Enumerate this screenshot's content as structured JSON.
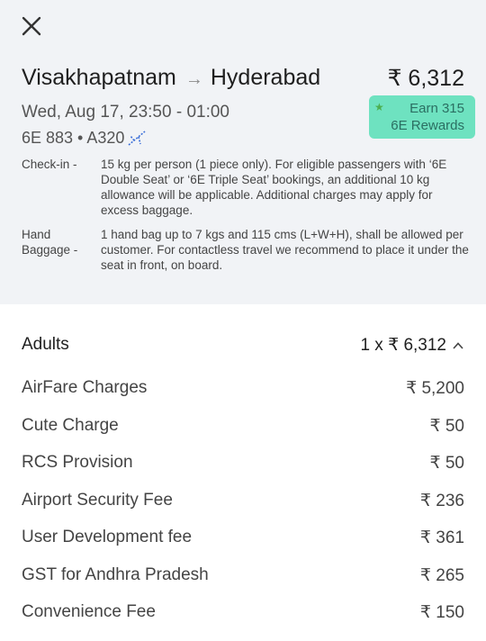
{
  "header": {
    "origin": "Visakhapatnam",
    "arrow": "→",
    "destination": "Hyderabad",
    "price": "₹ 6,312",
    "datetime": "Wed, Aug 17, 23:50 - 01:00",
    "flight": "6E 883 • A320",
    "rewards_line1": "Earn 315",
    "rewards_line2": "6E Rewards"
  },
  "baggage": {
    "checkin_label": "Check-in -",
    "checkin_text": "15 kg per person (1 piece only). For eligible passengers with ‘6E Double Seat’ or ‘6E Triple Seat’ bookings, an additional 10 kg allowance will be applicable. Additional charges may apply for excess baggage.",
    "hand_label_1": "Hand",
    "hand_label_2": "Baggage -",
    "hand_text": "1 hand bag up to 7 kgs and 115 cms (L+W+H), shall be allowed per customer. For contactless travel we recommend to place it under the seat in front, on board."
  },
  "fare": {
    "adults_label": "Adults",
    "adults_total": "1 x ₹ 6,312",
    "items": [
      {
        "name": "AirFare Charges",
        "amount": "₹ 5,200"
      },
      {
        "name": "Cute Charge",
        "amount": "₹ 50"
      },
      {
        "name": "RCS Provision",
        "amount": "₹ 50"
      },
      {
        "name": "Airport Security Fee",
        "amount": "₹ 236"
      },
      {
        "name": "User Development fee",
        "amount": "₹ 361"
      },
      {
        "name": "GST for Andhra Pradesh",
        "amount": "₹ 265"
      },
      {
        "name": "Convenience Fee",
        "amount": "₹ 150"
      }
    ]
  },
  "colors": {
    "rewards_bg": "#6ee2c0",
    "top_bg": "#f1f3f6"
  },
  "icons": {
    "close": "close-icon",
    "plane": "plane-icon",
    "chevron": "chevron-up-icon",
    "star": "star-icon"
  }
}
